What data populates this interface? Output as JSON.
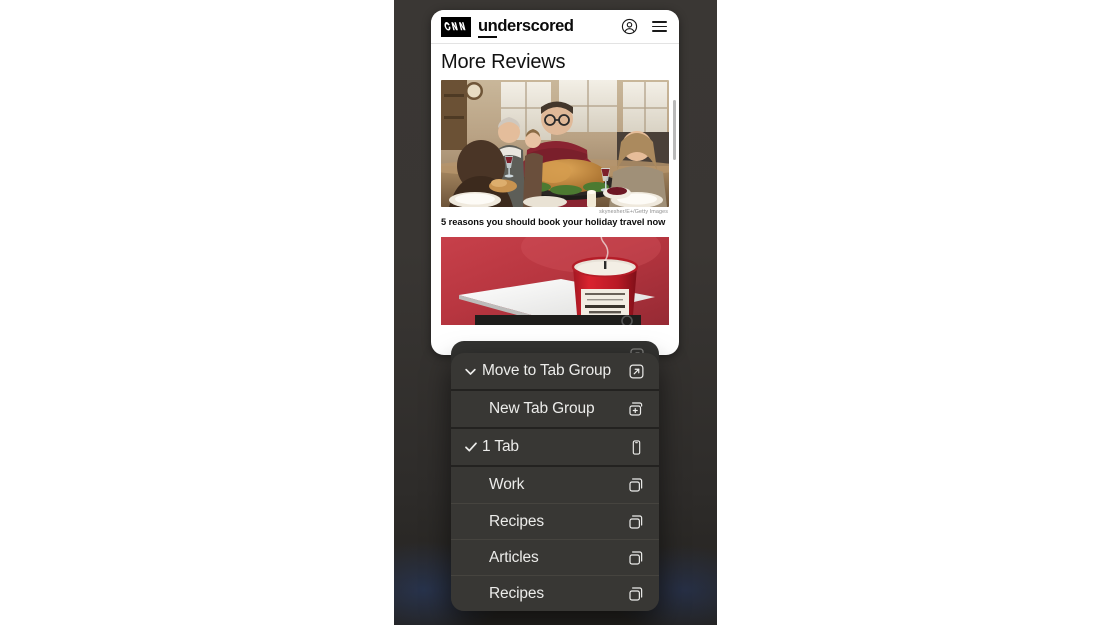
{
  "browser": {
    "site_header": {
      "logo_text": "CNN",
      "brand_prefix": "un",
      "brand_rest": "derscored",
      "brand_full": "underscored",
      "account_icon": "account-circle-icon",
      "menu_icon": "hamburger-menu-icon"
    },
    "page_title": "More Reviews",
    "articles": [
      {
        "image_alt": "family-thanksgiving-dinner-photo",
        "credit": "skynesher/E+/Getty Images",
        "headline": "5 reasons you should book your holiday travel now"
      },
      {
        "image_alt": "red-candle-on-table-photo",
        "credit": "",
        "headline": ""
      }
    ]
  },
  "peek_row": {
    "label": "",
    "icon": "arrow-up-right-square-icon"
  },
  "context_menu": {
    "sections": [
      {
        "name": "tab-group-header",
        "items": [
          {
            "label": "Move to Tab Group",
            "lead_icon": "chevron-down-icon",
            "trail_icon": "arrow-up-right-square-icon",
            "checked": false,
            "indent": false
          }
        ]
      },
      {
        "name": "new-group",
        "items": [
          {
            "label": "New Tab Group",
            "lead_icon": "",
            "trail_icon": "plus-square-stack-icon",
            "checked": false,
            "indent": true
          }
        ]
      },
      {
        "name": "current-tab",
        "items": [
          {
            "label": "1 Tab",
            "lead_icon": "checkmark-icon",
            "trail_icon": "phone-icon",
            "checked": true,
            "indent": false
          }
        ]
      },
      {
        "name": "tab-groups-list",
        "items": [
          {
            "label": "Work",
            "lead_icon": "",
            "trail_icon": "square-stack-icon",
            "checked": false,
            "indent": true
          },
          {
            "label": "Recipes",
            "lead_icon": "",
            "trail_icon": "square-stack-icon",
            "checked": false,
            "indent": true
          },
          {
            "label": "Articles",
            "lead_icon": "",
            "trail_icon": "square-stack-icon",
            "checked": false,
            "indent": true
          },
          {
            "label": "Recipes",
            "lead_icon": "",
            "trail_icon": "square-stack-icon",
            "checked": false,
            "indent": true
          }
        ]
      }
    ]
  },
  "colors": {
    "menu_bg": "#2f2e2c",
    "menu_group_bg": "#383734",
    "menu_text": "#ececea",
    "device_bg": "#393633",
    "page_bg": "#ffffff",
    "brand_black": "#000000"
  }
}
